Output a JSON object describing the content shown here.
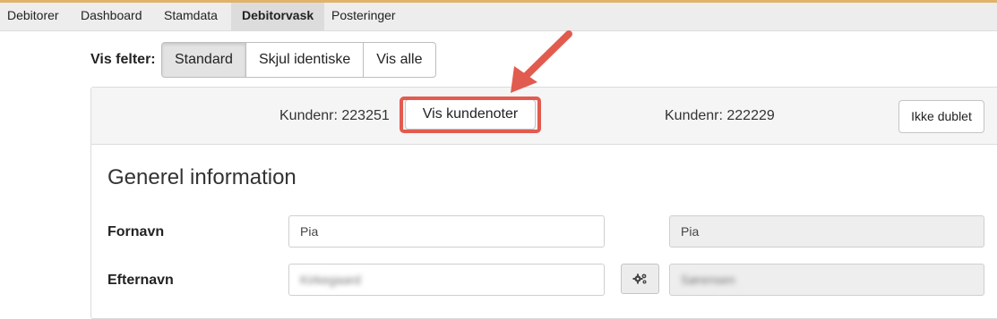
{
  "nav": {
    "tabs": [
      {
        "label": "Debitorer"
      },
      {
        "label": "Dashboard"
      },
      {
        "label": "Stamdata"
      },
      {
        "label": "Debitorvask"
      },
      {
        "label": "Posteringer"
      }
    ]
  },
  "filter": {
    "label": "Vis felter:",
    "options": [
      "Standard",
      "Skjul identiske",
      "Vis alle"
    ],
    "selected": "Standard"
  },
  "header": {
    "left_customer": "Kundenr: 223251",
    "notes_button": "Vis kundenoter",
    "right_customer": "Kundenr: 222229",
    "not_duplicate_button": "Ikke dublet"
  },
  "section": {
    "title": "Generel information",
    "fields": [
      {
        "label": "Fornavn",
        "left_value": "Pia",
        "right_value": "Pia"
      },
      {
        "label": "Efternavn",
        "left_value": "Kirkegaard",
        "right_value": "Sørensen"
      }
    ]
  },
  "colors": {
    "highlight": "#e25b4f",
    "accent_bar": "#e0b26a"
  },
  "icons": {
    "merge": "gears-icon",
    "pointer": "arrow-icon"
  }
}
